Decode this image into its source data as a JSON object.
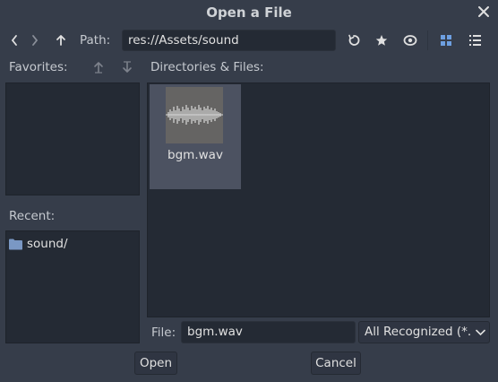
{
  "dialog": {
    "title": "Open a File"
  },
  "toolbar": {
    "path_label": "Path:",
    "path_value": "res://Assets/sound",
    "icons": [
      "back-icon",
      "forward-icon",
      "go-up-icon",
      "refresh-icon",
      "favorite-star-icon",
      "toggle-hidden-eye-icon",
      "grid-view-icon",
      "list-view-icon"
    ]
  },
  "favorites": {
    "label": "Favorites:",
    "icons": [
      "move-favorite-up-icon",
      "move-favorite-down-icon"
    ]
  },
  "recent": {
    "label": "Recent:",
    "items": [
      {
        "label": "sound/",
        "icon": "folder-icon"
      }
    ]
  },
  "files": {
    "label": "Directories & Files:",
    "items": [
      {
        "name": "bgm.wav",
        "icon": "waveform-thumbnail-icon",
        "selected": true
      }
    ]
  },
  "footer": {
    "file_label": "File:",
    "file_value": "bgm.wav",
    "filter_value": "All Recognized (*.",
    "open_label": "Open",
    "cancel_label": "Cancel"
  },
  "colors": {
    "background": "#363d4a",
    "panel": "#242a34",
    "accent": "#6d9fe0",
    "selection": "#4c5261"
  }
}
